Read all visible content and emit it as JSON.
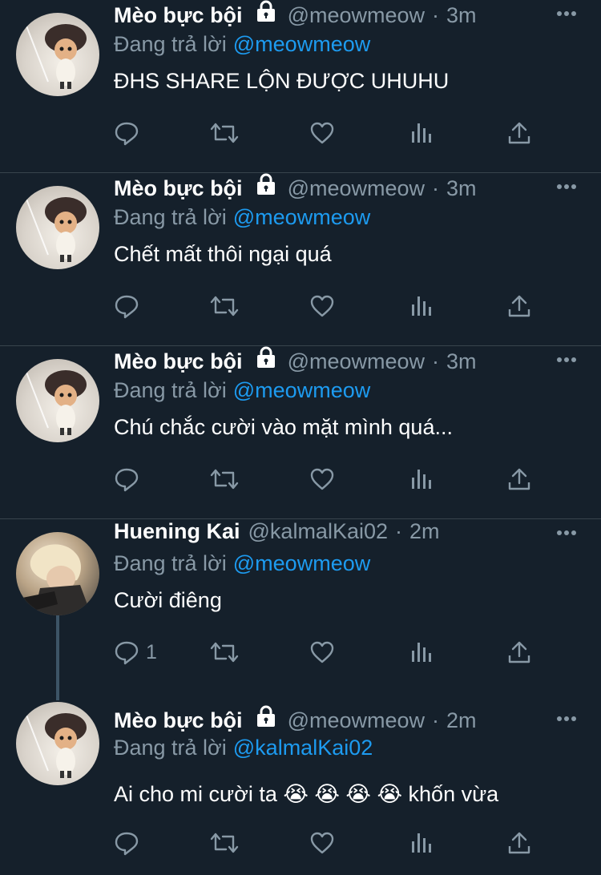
{
  "tweets": [
    {
      "name": "Mèo bực bội",
      "handle": "@meowmeow",
      "sep": "·",
      "time": "3m",
      "reply_label": "Đang trả lời",
      "reply_to": "@meowmeow",
      "text": "ĐHS SHARE LỘN ĐƯỢC UHUHU",
      "avatar": "cat-icon",
      "locked": true,
      "reply_count": ""
    },
    {
      "name": "Mèo bực bội",
      "handle": "@meowmeow",
      "sep": "·",
      "time": "3m",
      "reply_label": "Đang trả lời",
      "reply_to": "@meowmeow",
      "text": "Chết mất thôi ngại quá",
      "avatar": "cat-icon",
      "locked": true,
      "reply_count": ""
    },
    {
      "name": "Mèo bực bội",
      "handle": "@meowmeow",
      "sep": "·",
      "time": "3m",
      "reply_label": "Đang trả lời",
      "reply_to": "@meowmeow",
      "text": "Chú chắc cười vào mặt mình quá...",
      "avatar": "cat-icon",
      "locked": true,
      "reply_count": ""
    },
    {
      "name": "Huening Kai",
      "handle": "@kalmalKai02",
      "sep": "·",
      "time": "2m",
      "reply_label": "Đang trả lời",
      "reply_to": "@meowmeow",
      "text": "Cười điêng",
      "avatar": "person-photo",
      "locked": false,
      "reply_count": "1"
    },
    {
      "name": "Mèo bực bội",
      "handle": "@meowmeow",
      "sep": "·",
      "time": "2m",
      "reply_label": "Đang trả lời",
      "reply_to": "@kalmalKai02",
      "text": "Ai cho mi cười ta 😭 😭 😭 😭 khốn vừa",
      "avatar": "cat-icon",
      "locked": true,
      "reply_count": ""
    }
  ],
  "icons": {
    "reply": "reply-icon",
    "retweet": "retweet-icon",
    "like": "heart-icon",
    "analytics": "analytics-icon",
    "share": "share-icon",
    "more": "more-icon",
    "lock": "lock-icon"
  },
  "colors": {
    "background": "#15202b",
    "text": "#ffffff",
    "secondary": "#8899a6",
    "link": "#1d9bf0",
    "divider": "#38444d"
  }
}
